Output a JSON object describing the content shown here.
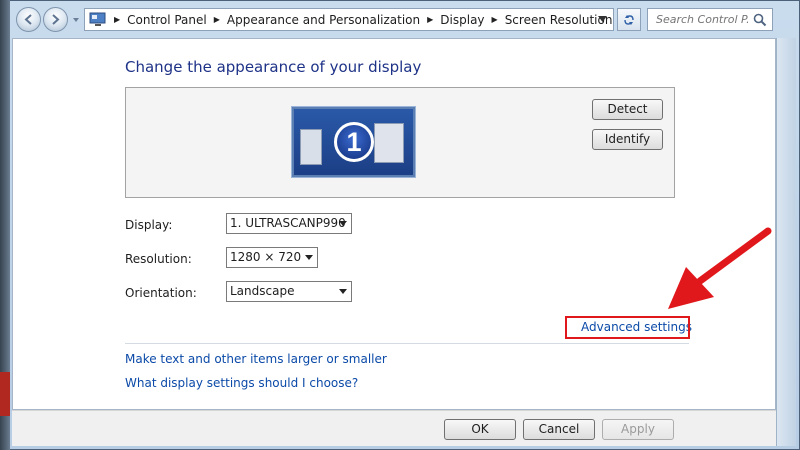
{
  "breadcrumb": [
    "Control Panel",
    "Appearance and Personalization",
    "Display",
    "Screen Resolution"
  ],
  "search": {
    "placeholder": "Search Control P..."
  },
  "main": {
    "heading": "Change the appearance of your display",
    "monitor_number": "1",
    "detect_label": "Detect",
    "identify_label": "Identify",
    "display_label": "Display:",
    "display_value": "1. ULTRASCANP990",
    "resolution_label": "Resolution:",
    "resolution_value": "1280 × 720",
    "orientation_label": "Orientation:",
    "orientation_value": "Landscape",
    "advanced_link": "Advanced settings",
    "links": [
      "Make text and other items larger or smaller",
      "What display settings should I choose?"
    ]
  },
  "footer": {
    "ok_label": "OK",
    "cancel_label": "Cancel",
    "apply_label": "Apply"
  },
  "colors": {
    "annotation": "#e0181b",
    "link": "#0b4aa8",
    "heading": "#1e3287"
  }
}
